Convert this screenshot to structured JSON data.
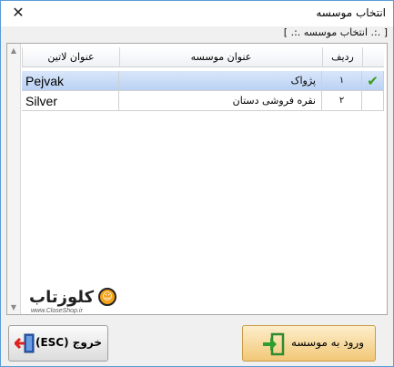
{
  "window": {
    "title": "انتخاب موسسه"
  },
  "group": {
    "label": "[ .:. انتخاب موسسه .:. ]"
  },
  "table": {
    "headers": {
      "row_no": "ردیف",
      "title": "عنوان موسسه",
      "latin": "عنوان لاتین"
    },
    "rows": [
      {
        "row_no": "۱",
        "title": "پژواک",
        "latin": "Pejvak",
        "selected": true
      },
      {
        "row_no": "۲",
        "title": "نقره فروشی دستان",
        "latin": "Silver",
        "selected": false
      }
    ]
  },
  "logo": {
    "text": "کلوزتاب",
    "sub": "www.CloseShop.ir"
  },
  "buttons": {
    "exit": "خروج (ESC)",
    "enter": "ورود به موسسه"
  },
  "icons": {
    "close": "close-icon",
    "selected_mark": "checkmark-icon",
    "exit": "exit-door-icon",
    "enter": "enter-arrow-icon"
  },
  "colors": {
    "selected_row": "#c8dcf6",
    "enter_button": "#f5d391",
    "checkmark": "#3a9d1c",
    "exit_icon": "#2a5db0"
  }
}
